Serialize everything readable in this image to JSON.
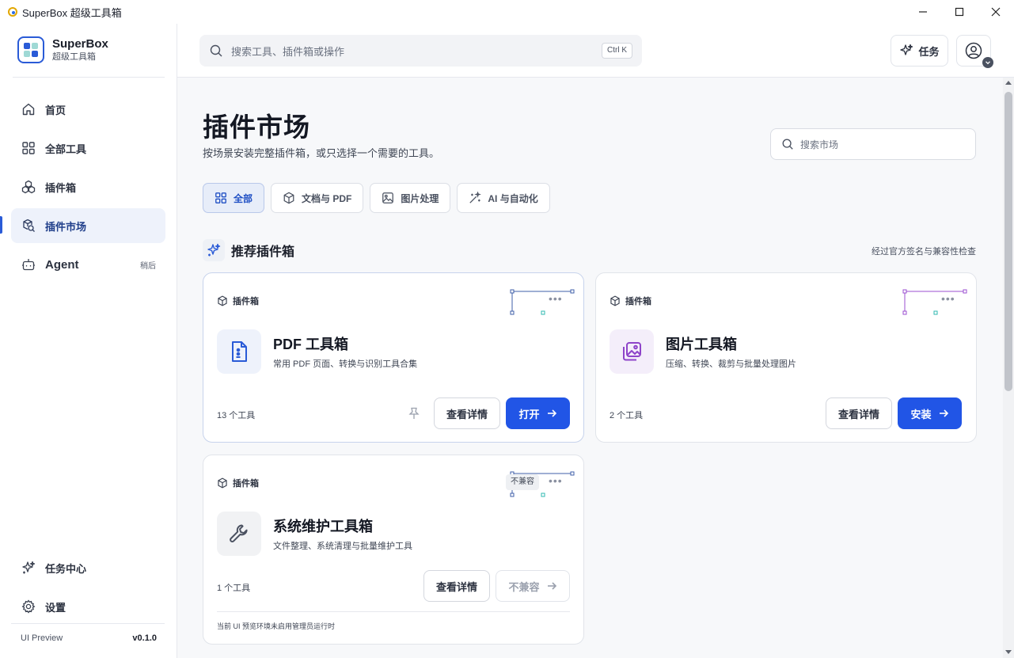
{
  "window": {
    "title": "SuperBox 超级工具箱"
  },
  "brand": {
    "name": "SuperBox",
    "subtitle": "超级工具箱"
  },
  "sidebar": {
    "items": [
      {
        "label": "首页",
        "icon": "home-icon"
      },
      {
        "label": "全部工具",
        "icon": "grid-icon"
      },
      {
        "label": "插件箱",
        "icon": "boxes-icon"
      },
      {
        "label": "插件市场",
        "icon": "market-search-icon",
        "active": true
      },
      {
        "label": "Agent",
        "icon": "bot-icon",
        "badge": "稍后"
      }
    ],
    "bottom_items": [
      {
        "label": "任务中心",
        "icon": "sparkle-icon"
      },
      {
        "label": "设置",
        "icon": "gear-icon"
      }
    ],
    "footer": {
      "env": "UI Preview",
      "version": "v0.1.0"
    }
  },
  "topbar": {
    "search_placeholder": "搜索工具、插件箱或操作",
    "shortcut": "Ctrl K",
    "task_button": "任务"
  },
  "page": {
    "title": "插件市场",
    "subtitle": "按场景安装完整插件箱，或只选择一个需要的工具。",
    "search_placeholder": "搜索市场",
    "filters": [
      {
        "label": "全部",
        "icon": "grid-icon",
        "active": true
      },
      {
        "label": "文档与 PDF",
        "icon": "cube-icon"
      },
      {
        "label": "图片处理",
        "icon": "image-icon"
      },
      {
        "label": "AI 与自动化",
        "icon": "wand-icon"
      }
    ],
    "section": {
      "title": "推荐插件箱",
      "note": "经过官方签名与兼容性检查"
    }
  },
  "cards": [
    {
      "kind": "插件箱",
      "name": "PDF 工具箱",
      "desc": "常用 PDF 页面、转换与识别工具合集",
      "count": "13 个工具",
      "details_label": "查看详情",
      "action_label": "打开",
      "accent": "#2a5bd7"
    },
    {
      "kind": "插件箱",
      "name": "图片工具箱",
      "desc": "压缩、转换、裁剪与批量处理图片",
      "count": "2 个工具",
      "details_label": "查看详情",
      "action_label": "安装",
      "accent": "#9b4fd1"
    },
    {
      "kind": "插件箱",
      "name": "系统维护工具箱",
      "desc": "文件整理、系统清理与批量维护工具",
      "count": "1 个工具",
      "details_label": "查看详情",
      "action_label": "不兼容",
      "tag": "不兼容",
      "note": "当前 UI 预览环境未启用管理员运行时",
      "accent": "#2a5bd7"
    }
  ],
  "colors": {
    "primary": "#2155e6",
    "active_nav_bg": "#eef2fb",
    "teal_handle": "#2fb8b0"
  }
}
